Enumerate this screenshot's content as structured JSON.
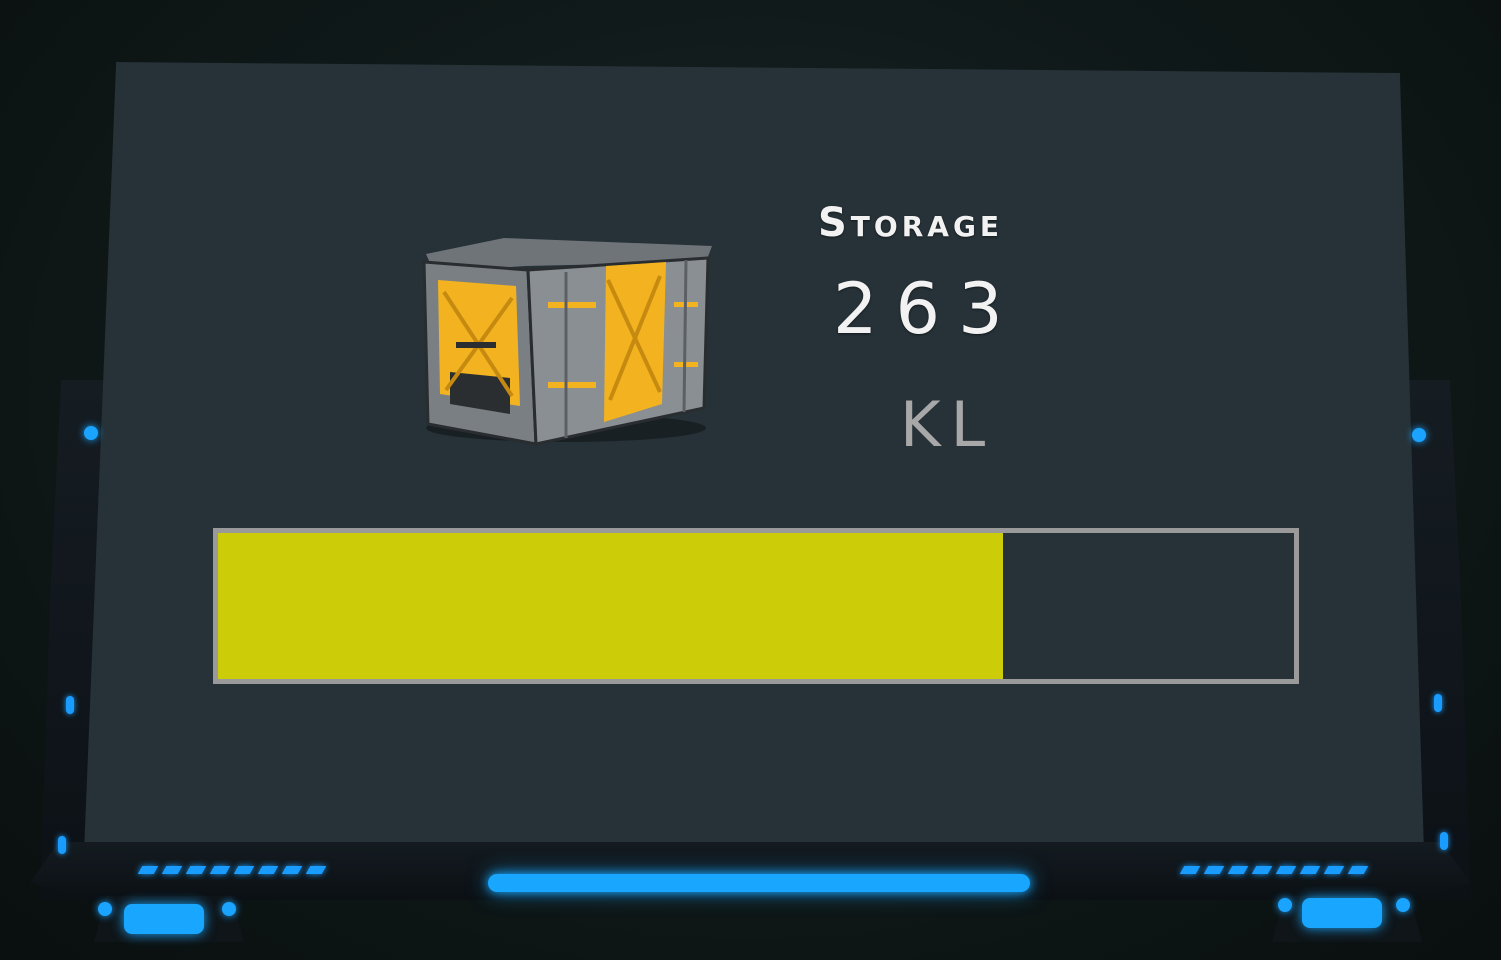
{
  "panel": {
    "title": "Storage",
    "value": "263",
    "unit": "KL",
    "icon": "storage-crate-icon"
  },
  "progress": {
    "fraction": 0.73,
    "fill_color": "#cccc08",
    "track_color": "#263238",
    "border_color": "#9a9a9a"
  },
  "colors": {
    "screen": "#263238",
    "glow": "#18a6ff"
  }
}
